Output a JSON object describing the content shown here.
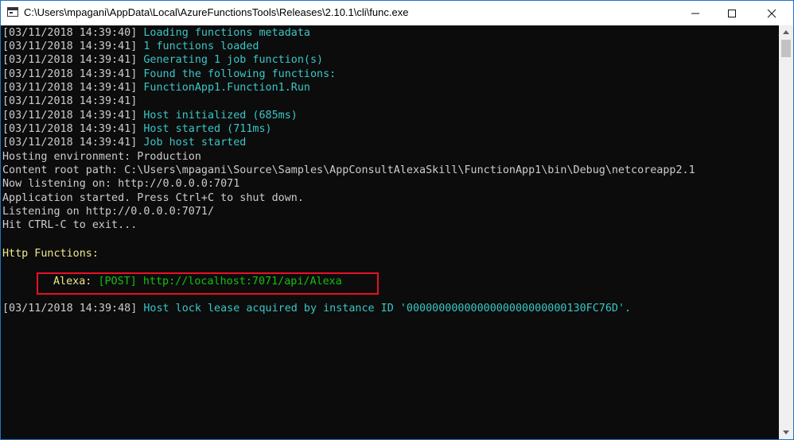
{
  "window": {
    "title": "C:\\Users\\mpagani\\AppData\\Local\\AzureFunctionsTools\\Releases\\2.10.1\\cli\\func.exe",
    "controls": {
      "minimize": "minimize-icon",
      "maximize": "maximize-icon",
      "close": "close-icon"
    }
  },
  "colors": {
    "cyan": "#3ac6c7",
    "gray": "#cccccc",
    "yellow": "#f1e68a",
    "green": "#13c00c",
    "highlight": "#e81123"
  },
  "console": {
    "log": [
      {
        "ts": "[03/11/2018 14:39:40]",
        "msg": " Loading functions metadata"
      },
      {
        "ts": "[03/11/2018 14:39:41]",
        "msg": " 1 functions loaded"
      },
      {
        "ts": "[03/11/2018 14:39:41]",
        "msg": " Generating 1 job function(s)"
      },
      {
        "ts": "[03/11/2018 14:39:41]",
        "msg": " Found the following functions:"
      },
      {
        "ts": "[03/11/2018 14:39:41]",
        "msg": " FunctionApp1.Function1.Run"
      },
      {
        "ts": "[03/11/2018 14:39:41]",
        "msg": ""
      },
      {
        "ts": "[03/11/2018 14:39:41]",
        "msg": " Host initialized (685ms)"
      },
      {
        "ts": "[03/11/2018 14:39:41]",
        "msg": " Host started (711ms)"
      },
      {
        "ts": "[03/11/2018 14:39:41]",
        "msg": " Job host started"
      }
    ],
    "info": [
      "Hosting environment: Production",
      "Content root path: C:\\Users\\mpagani\\Source\\Samples\\AppConsultAlexaSkill\\FunctionApp1\\bin\\Debug\\netcoreapp2.1",
      "Now listening on: http://0.0.0.0:7071",
      "Application started. Press Ctrl+C to shut down.",
      "Listening on http://0.0.0.0:7071/",
      "Hit CTRL-C to exit..."
    ],
    "http_heading": "Http Functions:",
    "function_entry": {
      "name": "Alexa:",
      "method": "[POST]",
      "url": "http://localhost:7071/api/Alexa"
    },
    "final": {
      "ts": "[03/11/2018 14:39:48]",
      "msg": " Host lock lease acquired by instance ID '0000000000000000000000000130FC76D'."
    }
  }
}
